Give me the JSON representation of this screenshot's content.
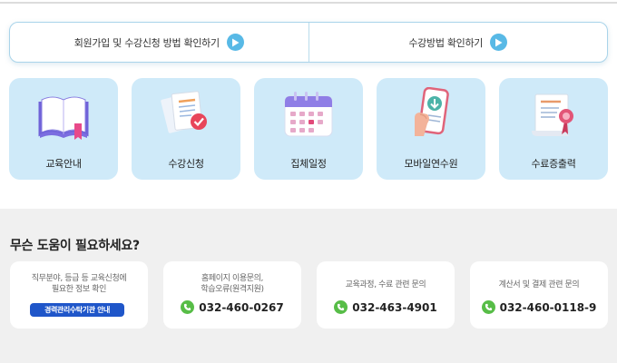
{
  "guide": {
    "items": [
      {
        "label": "회원가입 및 수강신청 방법 확인하기",
        "icon": "play-icon"
      },
      {
        "label": "수강방법 확인하기",
        "icon": "play-icon"
      }
    ]
  },
  "cards": [
    {
      "label": "교육안내",
      "icon": "book-icon"
    },
    {
      "label": "수강신청",
      "icon": "document-check-icon"
    },
    {
      "label": "집체일정",
      "icon": "calendar-icon"
    },
    {
      "label": "모바일연수원",
      "icon": "mobile-phone-icon"
    },
    {
      "label": "수료증출력",
      "icon": "certificate-icon"
    }
  ],
  "help": {
    "title": "무슨 도움이 필요하세요?",
    "cards": [
      {
        "desc_line1": "직무분야, 등급 등 교육신청에",
        "desc_line2": "필요한 정보 확인",
        "button": "경력관리수탁기관 안내"
      },
      {
        "desc_line1": "홈페이지 이용문의,",
        "desc_line2": "학습오류(원격지원)",
        "phone": "032-460-0267"
      },
      {
        "desc_line1": "교육과정, 수료 관련 문의",
        "phone": "032-463-4901"
      },
      {
        "desc_line1": "계산서 및 결제 관련 문의",
        "phone": "032-460-0118-9"
      }
    ]
  },
  "colors": {
    "accent": "#1f56c9",
    "card_bg": "#cfeaf9",
    "play": "#58b9e6",
    "phone": "#57bd47",
    "help_bg": "#f0f0f0"
  }
}
